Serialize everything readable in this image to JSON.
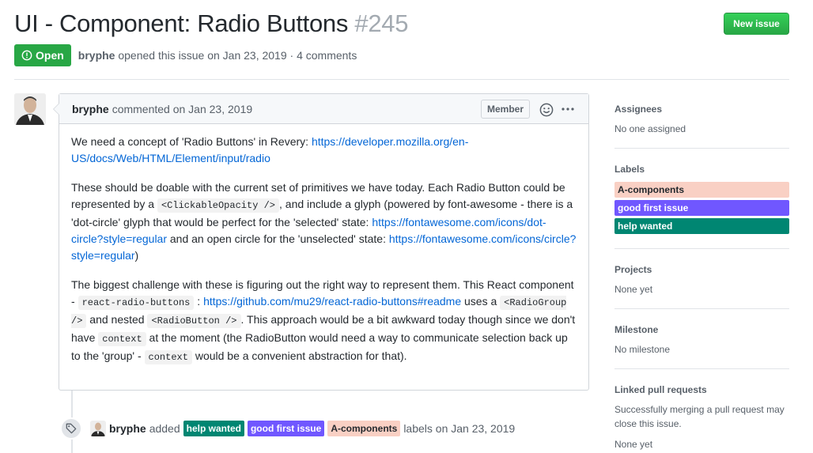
{
  "issue": {
    "title": "UI - Component: Radio Buttons",
    "number": "#245",
    "new_issue_label": "New issue",
    "state": "Open",
    "author": "bryphe",
    "meta_rest": "opened this issue on Jan 23, 2019 · 4 comments"
  },
  "comment": {
    "author": "bryphe",
    "commented_on": "commented on Jan 23, 2019",
    "badge": "Member",
    "p1_text": "We need a concept of 'Radio Buttons' in Revery: ",
    "p1_link": "https://developer.mozilla.org/en-US/docs/Web/HTML/Element/input/radio",
    "p2_a": "These should be doable with the current set of primitives we have today. Each Radio Button could be represented by a ",
    "p2_code": "<ClickableOpacity />",
    "p2_b": ", and include a glyph (powered by font-awesome - there is a 'dot-circle' glyph that would be perfect for the 'selected' state: ",
    "p2_link1": "https://fontawesome.com/icons/dot-circle?style=regular",
    "p2_c": " and an open circle for the 'unselected' state: ",
    "p2_link2": "https://fontawesome.com/icons/circle?style=regular",
    "p2_d": ")",
    "p3_a": "The biggest challenge with these is figuring out the right way to represent them. This React component - ",
    "p3_code1": "react-radio-buttons",
    "p3_b": " : ",
    "p3_link": "https://github.com/mu29/react-radio-buttons#readme",
    "p3_c": " uses a ",
    "p3_code2": "<RadioGroup />",
    "p3_d": " and nested ",
    "p3_code3": "<RadioButton />",
    "p3_e": ". This approach would be a bit awkward today though since we don't have ",
    "p3_code4": "context",
    "p3_f": " at the moment (the RadioButton would need a way to communicate selection back up to the 'group' - ",
    "p3_code5": "context",
    "p3_g": " would be a convenient abstraction for that)."
  },
  "event": {
    "author": "bryphe",
    "action": "added",
    "suffix": "labels on Jan 23, 2019"
  },
  "labels": [
    {
      "name": "A-components",
      "bg": "#f9d0c4",
      "fg": "#24292e"
    },
    {
      "name": "good first issue",
      "bg": "#7057ff",
      "fg": "#ffffff"
    },
    {
      "name": "help wanted",
      "bg": "#008672",
      "fg": "#ffffff"
    }
  ],
  "event_labels_order": [
    "help wanted",
    "good first issue",
    "A-components"
  ],
  "sidebar": {
    "assignees": {
      "heading": "Assignees",
      "value": "No one assigned"
    },
    "labels": {
      "heading": "Labels"
    },
    "projects": {
      "heading": "Projects",
      "value": "None yet"
    },
    "milestone": {
      "heading": "Milestone",
      "value": "No milestone"
    },
    "linked": {
      "heading": "Linked pull requests",
      "value": "Successfully merging a pull request may close this issue.",
      "value2": "None yet"
    }
  },
  "colors": {
    "open_green": "#28a745",
    "link": "#0366d6"
  }
}
